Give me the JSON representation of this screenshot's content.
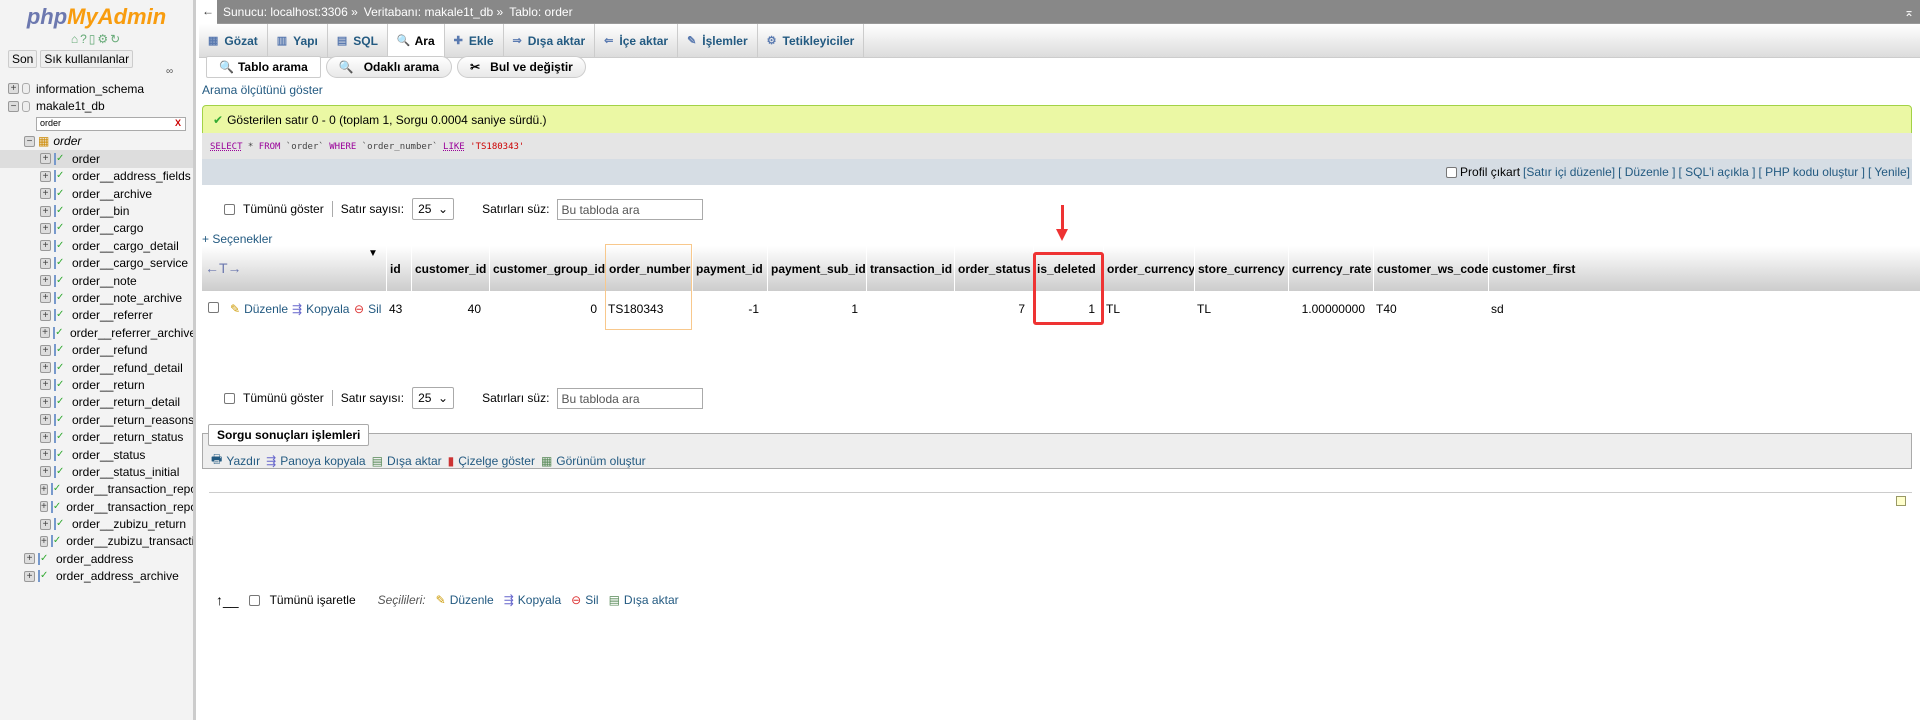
{
  "sidebar": {
    "logo": {
      "php": "php",
      "myadmin": "MyAdmin"
    },
    "buttons": [
      "Son",
      "Sık kullanılanlar"
    ],
    "databases": [
      "information_schema",
      "makale1t_db"
    ],
    "filter_value": "order",
    "filter_clear": "X",
    "group": "order",
    "tables": [
      "order",
      "order__address_fields",
      "order__archive",
      "order__bin",
      "order__cargo",
      "order__cargo_detail",
      "order__cargo_service",
      "order__note",
      "order__note_archive",
      "order__referrer",
      "order__referrer_archive",
      "order__refund",
      "order__refund_detail",
      "order__return",
      "order__return_detail",
      "order__return_reasons",
      "order__return_status",
      "order__status",
      "order__status_initial",
      "order__transaction_report",
      "order__transaction_report",
      "order__zubizu_return",
      "order__zubizu_transaction"
    ],
    "more_tables": [
      "order_address",
      "order_address_archive"
    ]
  },
  "breadcrumb": {
    "server": "Sunucu: localhost:3306 »",
    "database": "Veritabanı: makale1t_db »",
    "table": "Tablo: order"
  },
  "tabs": [
    {
      "label": "Gözat",
      "icon": "▦"
    },
    {
      "label": "Yapı",
      "icon": "▥"
    },
    {
      "label": "SQL",
      "icon": "▤"
    },
    {
      "label": "Ara",
      "icon": "🔍"
    },
    {
      "label": "Ekle",
      "icon": "✚"
    },
    {
      "label": "Dışa aktar",
      "icon": "⇒"
    },
    {
      "label": "İçe aktar",
      "icon": "⇐"
    },
    {
      "label": "İşlemler",
      "icon": "✎"
    },
    {
      "label": "Tetikleyiciler",
      "icon": "⚙"
    }
  ],
  "subtabs": [
    "Tablo arama",
    "Odaklı arama",
    "Bul ve değiştir"
  ],
  "criteria_link": "Arama ölçütünü göster",
  "success": "Gösterilen satır 0 - 0 (toplam 1, Sorgu 0.0004 saniye sürdü.)",
  "sql": {
    "select": "SELECT",
    "star": " * ",
    "from": "FROM",
    "t": " `order` ",
    "where": "WHERE",
    "col": " `order_number` ",
    "like": "LIKE",
    "val": " 'TS180343'"
  },
  "tools": {
    "profile": "Profil çıkart",
    "links": [
      "[Satır içi düzenle]",
      "[ Düzenle ]",
      "[ SQL'i açıkla ]",
      "[ PHP kodu oluştur ]",
      "[ Yenile]"
    ]
  },
  "nav": {
    "show_all": "Tümünü göster",
    "rows_label": "Satır sayısı:",
    "rows_value": "25",
    "filter_label": "Satırları süz:",
    "filter_placeholder": "Bu tabloda ara"
  },
  "options_link": "+ Seçenekler",
  "columns": [
    "id",
    "customer_id",
    "customer_group_id",
    "order_number",
    "payment_id",
    "payment_sub_id",
    "transaction_id",
    "order_status",
    "is_deleted",
    "order_currency",
    "store_currency",
    "currency_rate",
    "customer_ws_code",
    "customer_first"
  ],
  "row": {
    "actions": [
      "Düzenle",
      "Kopyala",
      "Sil"
    ],
    "values": [
      "43",
      "40",
      "0",
      "TS180343",
      "-1",
      "1",
      "",
      "7",
      "1",
      "TL",
      "TL",
      "1.00000000",
      "T40",
      "sd"
    ]
  },
  "bulk": {
    "check_all": "Tümünü işaretle",
    "selected": "Seçilileri:",
    "actions": [
      "Düzenle",
      "Kopyala",
      "Sil",
      "Dışa aktar"
    ]
  },
  "query_ops": {
    "legend": "Sorgu sonuçları işlemleri",
    "actions": [
      "Yazdır",
      "Panoya kopyala",
      "Dışa aktar",
      "Çizelge göster",
      "Görünüm oluştur"
    ]
  },
  "highlight_color": "#e33333"
}
